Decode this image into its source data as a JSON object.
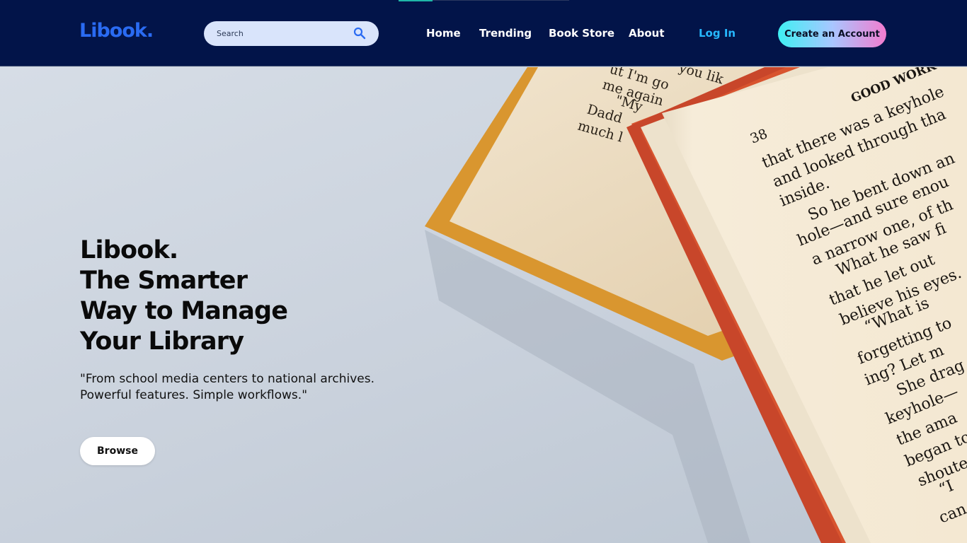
{
  "header": {
    "logo": "Libook.",
    "search": {
      "placeholder": "Search",
      "icon": "search-icon"
    },
    "nav": [
      {
        "label": "Home"
      },
      {
        "label": "Trending"
      },
      {
        "label": "Book Store"
      },
      {
        "label": "About"
      }
    ],
    "login_label": "Log In",
    "create_account_label": "Create an Account"
  },
  "hero": {
    "title_lines": [
      "Libook.",
      "The Smarter",
      "Way to Manage",
      "Your Library"
    ],
    "subtitle_lines": [
      "\"From school media centers to national archives.",
      "Powerful features. Simple workflows.\""
    ],
    "browse_label": "Browse",
    "image": {
      "subject": "open-books-photo",
      "back_book_text": [
        "ut I'm go",
        "me again",
        "\"My",
        "Dadd",
        "much l",
        "you lik"
      ],
      "page_header": "GOOD WORK",
      "page_number": "38",
      "page_text": [
        "that there was a keyhole",
        "and looked through tha",
        "inside.",
        "So he bent down an",
        "hole—and sure enou",
        "a narrow one, of th",
        "What he saw fi",
        "that he let out",
        "believe his eyes.",
        "“What is",
        "forgetting to",
        "ing? Let m",
        "She drag",
        "keyhole—",
        "the ama",
        "began to",
        "shoute",
        "“I",
        "can"
      ]
    }
  },
  "colors": {
    "header_bg": "#021449",
    "logo": "#2a6bf2",
    "login": "#26b8ff",
    "search_bg": "#d9e4fb",
    "cta_gradient": [
      "#3ff0f3",
      "#a8c6ff",
      "#f27ccf"
    ]
  }
}
